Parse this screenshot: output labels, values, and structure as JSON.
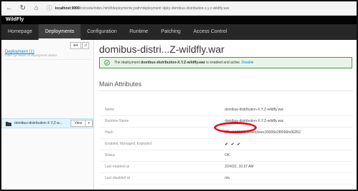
{
  "browser": {
    "url_host": "localhost:9990",
    "url_path": "/console/index.html#deployments;path=deployment~dpky-domibus-distribution-x.y.z-wildfly.war"
  },
  "brand": "WildFly",
  "nav": [
    "Homepage",
    "Deployments",
    "Configuration",
    "Runtime",
    "Patching",
    "Access Control"
  ],
  "left_panel": {
    "title": "Deployment (1)",
    "filter_placeholder": "Filter by: name or deployment status",
    "add_label": "⊕▾",
    "refresh_label": "↺",
    "item": {
      "label": "domibus-distribution-X.Y.Z-w...",
      "view_label": "View"
    }
  },
  "detail": {
    "title": "domibus-distri...Z-wildfly.war",
    "alert": {
      "prefix": "The deployment",
      "name": "domibus-distribution-X.Y.Z-wildfly.war",
      "suffix": "is enabled and active.",
      "link": "Disable"
    },
    "section": "Main Attributes",
    "attributes": [
      {
        "label": "Name",
        "value": "domibus-distribution-X.Y.Z-wildfly.war"
      },
      {
        "label": "Runtime Name",
        "value": "domibus-distribution-X.Y.Z-wildfly.war"
      },
      {
        "label": "Hash",
        "value": "67ba84859f1c8ea0cbeec39008e28f096fe0E852"
      },
      {
        "label": "Enabled, Managed, Exploded",
        "value": "✔ ✔ ✔"
      },
      {
        "label": "Status",
        "value": "OK"
      },
      {
        "label": "Last enabled at",
        "value": "2/24/22, 10:37 AM"
      },
      {
        "label": "Last disabled at",
        "value": "n/a"
      }
    ]
  },
  "colors": {
    "accent": "#0088ce",
    "success": "#3f9c35",
    "annotation": "#e0101a",
    "nav_bg": "#272727"
  }
}
